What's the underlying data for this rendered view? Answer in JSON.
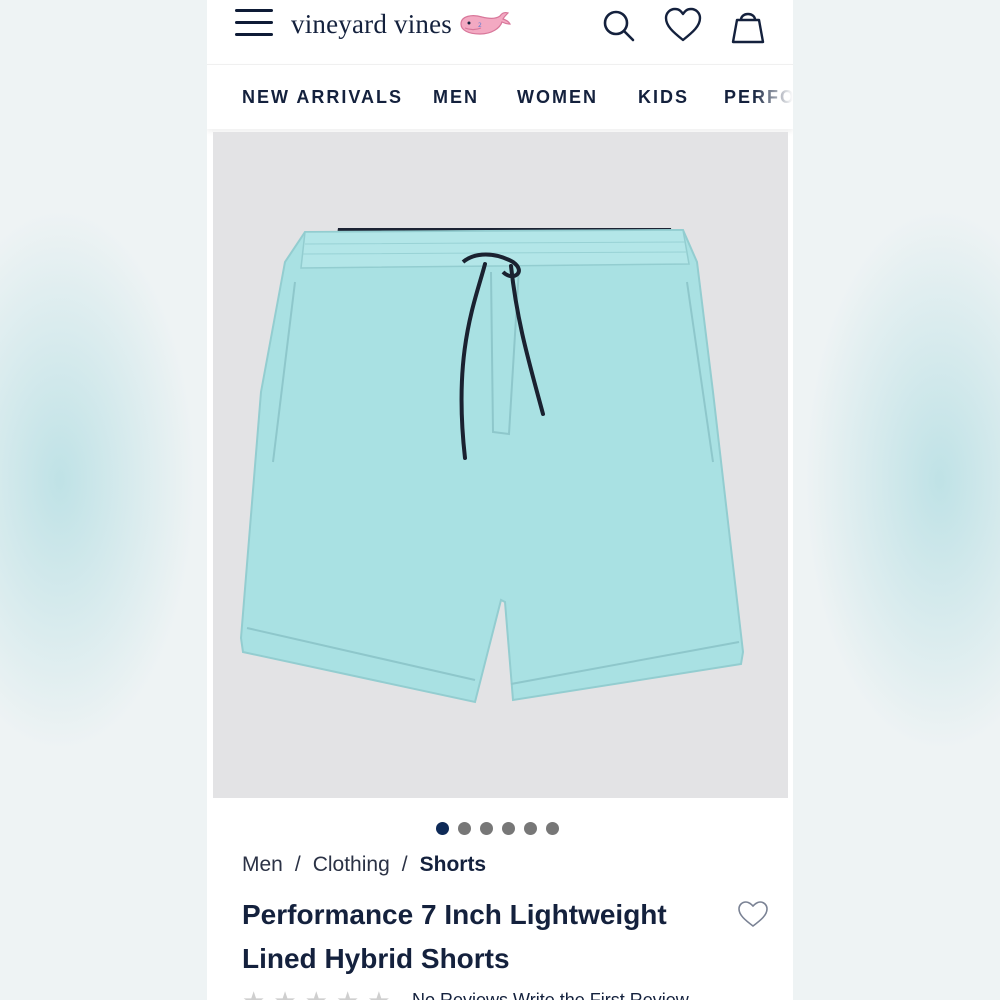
{
  "header": {
    "brand": "vineyard vines",
    "icons": [
      "menu-icon",
      "whale-logo",
      "search-icon",
      "heart-icon",
      "shopping-bag-icon"
    ]
  },
  "nav": {
    "items": [
      {
        "label": "NEW ARRIVALS"
      },
      {
        "label": "MEN"
      },
      {
        "label": "WOMEN"
      },
      {
        "label": "KIDS"
      },
      {
        "label": "PERFO"
      }
    ]
  },
  "gallery": {
    "image": "light aqua drawstring shorts",
    "total": 6,
    "active": 1
  },
  "breadcrumb": {
    "items": [
      "Men",
      "Clothing",
      "Shorts"
    ],
    "separator": "/"
  },
  "product": {
    "title_line1": "Performance 7 Inch Lightweight",
    "title_line2": "Lined Hybrid Shorts"
  },
  "reviews": {
    "stars": 5,
    "rating": 0,
    "text": "No Reviews   Write the First Review"
  },
  "colors": {
    "navy": "#14213d",
    "shorts": "#a9e1e3",
    "dot_active": "#0e2a57"
  }
}
